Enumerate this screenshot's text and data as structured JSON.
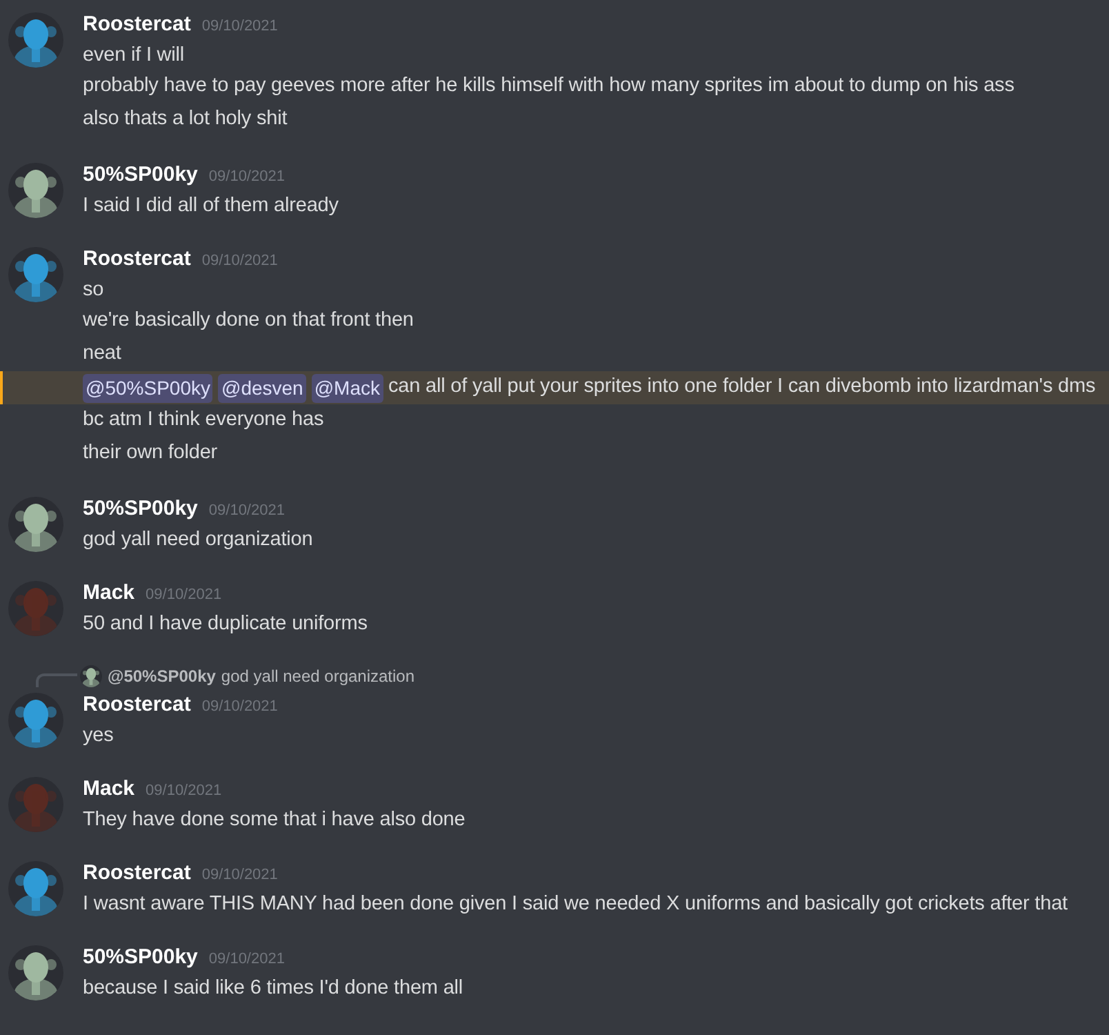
{
  "messages": [
    {
      "author": "Roostercat",
      "timestamp": "09/10/2021",
      "lines": [
        {
          "text": "even if I will"
        },
        {
          "text": "probably have to pay geeves more after he kills himself with how many sprites im about to dump on his ass"
        },
        {
          "text": "also thats a lot holy shit"
        }
      ]
    },
    {
      "author": "50%SP00ky",
      "timestamp": "09/10/2021",
      "lines": [
        {
          "text": "I said I did all of them already"
        }
      ]
    },
    {
      "author": "Roostercat",
      "timestamp": "09/10/2021",
      "lines": [
        {
          "text": "so"
        },
        {
          "text": "we're basically done on that front then"
        },
        {
          "text": "neat"
        },
        {
          "text": "can all of yall put your sprites into one folder I can divebomb into lizardman's dms",
          "mentions": [
            "@50%SP00ky",
            "@desven",
            "@Mack"
          ],
          "highlighted": true
        },
        {
          "text": "bc atm I think everyone has"
        },
        {
          "text": "their own folder"
        }
      ]
    },
    {
      "author": "50%SP00ky",
      "timestamp": "09/10/2021",
      "lines": [
        {
          "text": "god yall need organization"
        }
      ]
    },
    {
      "author": "Mack",
      "timestamp": "09/10/2021",
      "lines": [
        {
          "text": "50 and I have duplicate uniforms"
        }
      ]
    },
    {
      "author": "Roostercat",
      "timestamp": "09/10/2021",
      "reply": {
        "author": "@50%SP00ky",
        "text": "god yall need organization"
      },
      "lines": [
        {
          "text": "yes"
        }
      ]
    },
    {
      "author": "Mack",
      "timestamp": "09/10/2021",
      "lines": [
        {
          "text": "They have done some that i have also done"
        }
      ]
    },
    {
      "author": "Roostercat",
      "timestamp": "09/10/2021",
      "lines": [
        {
          "text": "I wasnt aware THIS MANY had been done given I said we needed X uniforms and basically got crickets after that"
        }
      ]
    },
    {
      "author": "50%SP00ky",
      "timestamp": "09/10/2021",
      "lines": [
        {
          "text": "because I said like 6 times I'd done them all"
        }
      ]
    }
  ]
}
